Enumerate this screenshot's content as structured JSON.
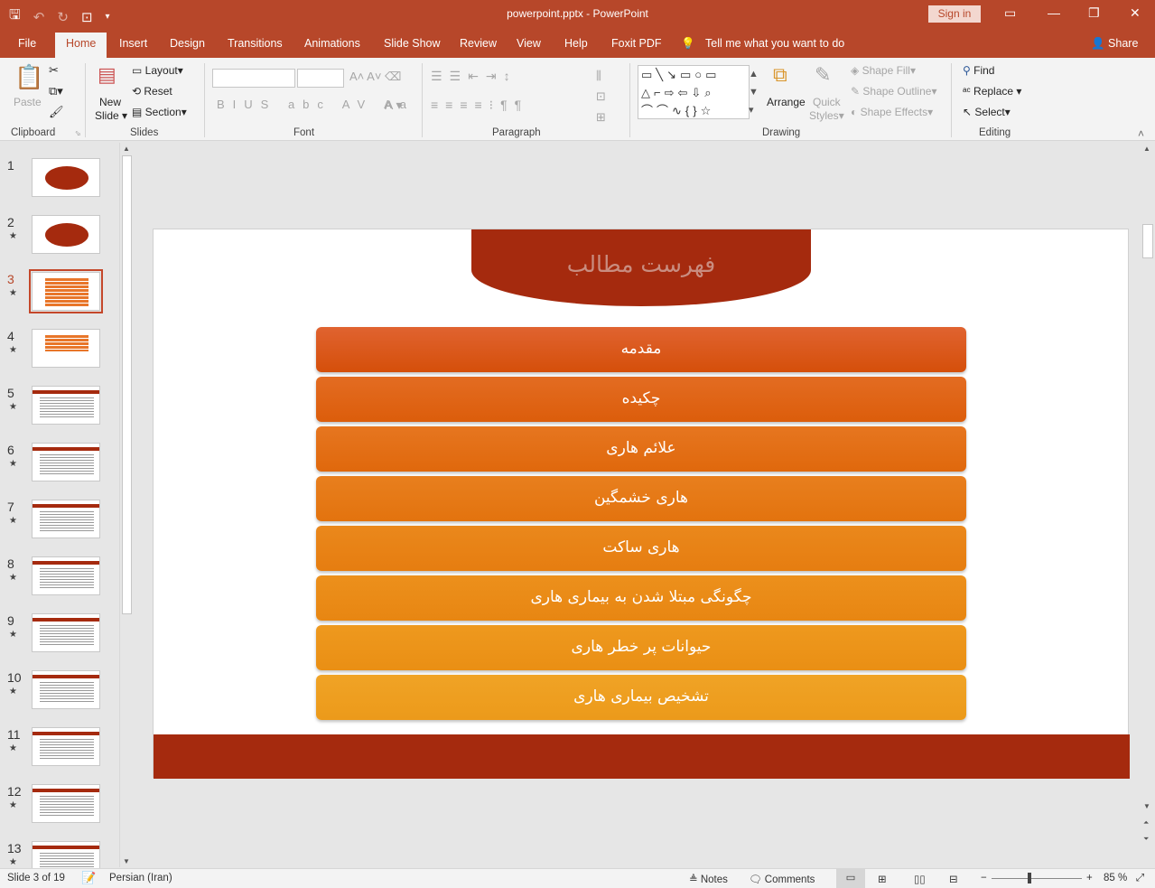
{
  "app": {
    "doc_title": "powerpoint.pptx  -  PowerPoint",
    "sign_in": "Sign in",
    "share": "Share",
    "tell_me": "Tell me what you want to do"
  },
  "menu_tabs": [
    "File",
    "Home",
    "Insert",
    "Design",
    "Transitions",
    "Animations",
    "Slide Show",
    "Review",
    "View",
    "Help",
    "Foxit PDF"
  ],
  "ribbon": {
    "clipboard": {
      "label": "Clipboard",
      "paste": "Paste"
    },
    "slides": {
      "label": "Slides",
      "new_slide": "New",
      "new_slide2": "Slide",
      "layout": "Layout",
      "reset": "Reset",
      "section": "Section"
    },
    "font": {
      "label": "Font"
    },
    "paragraph": {
      "label": "Paragraph"
    },
    "drawing": {
      "label": "Drawing",
      "arrange": "Arrange",
      "quick_styles": "Quick",
      "quick_styles2": "Styles",
      "shape_fill": "Shape Fill",
      "shape_outline": "Shape Outline",
      "shape_effects": "Shape Effects"
    },
    "editing": {
      "label": "Editing",
      "find": "Find",
      "replace": "Replace",
      "select": "Select"
    }
  },
  "thumbnails": [
    {
      "num": "1",
      "star": ""
    },
    {
      "num": "2",
      "star": "★"
    },
    {
      "num": "3",
      "star": "★"
    },
    {
      "num": "4",
      "star": "★"
    },
    {
      "num": "5",
      "star": "★"
    },
    {
      "num": "6",
      "star": "★"
    },
    {
      "num": "7",
      "star": "★"
    },
    {
      "num": "8",
      "star": "★"
    },
    {
      "num": "9",
      "star": "★"
    },
    {
      "num": "10",
      "star": "★"
    },
    {
      "num": "11",
      "star": "★"
    },
    {
      "num": "12",
      "star": "★"
    },
    {
      "num": "13",
      "star": "★"
    }
  ],
  "active_slide_index": 2,
  "slide": {
    "title": "فهرست مطالب",
    "items": [
      "مقدمه",
      "چکیده",
      "علائم هاری",
      "هاری خشمگین",
      "هاری ساکت",
      "چگونگی مبتلا شدن به بیماری هاری",
      "حیوانات پر خطر هاری",
      "تشخیص بیماری هاری"
    ],
    "colors": {
      "title_bg": "#a52a0e",
      "title_text": "#c98d80",
      "footer": "#a52a0e"
    }
  },
  "status": {
    "slide_info": "Slide 3 of 19",
    "language": "Persian (Iran)",
    "notes": "Notes",
    "comments": "Comments",
    "zoom": "85 %"
  }
}
